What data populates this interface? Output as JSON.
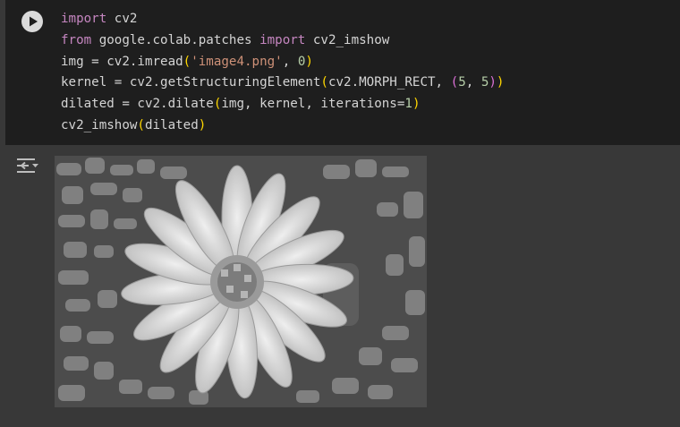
{
  "notebook": {
    "cell": {
      "run_button": {
        "icon": "play-icon"
      },
      "code_lines": [
        [
          {
            "t": "import",
            "c": "kw"
          },
          {
            "t": " cv2",
            "c": ""
          }
        ],
        [
          {
            "t": "from",
            "c": "kw"
          },
          {
            "t": " google.colab.patches ",
            "c": ""
          },
          {
            "t": "import",
            "c": "kw"
          },
          {
            "t": " cv2_imshow",
            "c": ""
          }
        ],
        [
          {
            "t": "img = cv2.imread",
            "c": ""
          },
          {
            "t": "(",
            "c": "p1"
          },
          {
            "t": "'image4.png'",
            "c": "str"
          },
          {
            "t": ", ",
            "c": ""
          },
          {
            "t": "0",
            "c": "num"
          },
          {
            "t": ")",
            "c": "p1"
          }
        ],
        [
          {
            "t": "kernel = cv2.getStructuringElement",
            "c": ""
          },
          {
            "t": "(",
            "c": "p1"
          },
          {
            "t": "cv2.MORPH_RECT, ",
            "c": ""
          },
          {
            "t": "(",
            "c": "p2"
          },
          {
            "t": "5",
            "c": "num"
          },
          {
            "t": ", ",
            "c": ""
          },
          {
            "t": "5",
            "c": "num"
          },
          {
            "t": ")",
            "c": "p2"
          },
          {
            "t": ")",
            "c": "p1"
          }
        ],
        [
          {
            "t": "dilated = cv2.dilate",
            "c": ""
          },
          {
            "t": "(",
            "c": "p1"
          },
          {
            "t": "img, kernel, iterations=",
            "c": ""
          },
          {
            "t": "1",
            "c": "num"
          },
          {
            "t": ")",
            "c": "p1"
          }
        ],
        [
          {
            "t": "cv2_imshow",
            "c": ""
          },
          {
            "t": "(",
            "c": "p1"
          },
          {
            "t": "dilated",
            "c": ""
          },
          {
            "t": ")",
            "c": "p1"
          }
        ]
      ]
    },
    "output": {
      "toggle_icon": "output-settings-icon",
      "image_description": "grayscale dilated flower photo"
    }
  },
  "colors": {
    "cell_bg": "#1e1e1e",
    "page_bg": "#383838",
    "keyword": "#c586c0",
    "string": "#ce9178",
    "number": "#b5cea8",
    "bracket_1": "#ffd700",
    "bracket_2": "#da70d6"
  }
}
